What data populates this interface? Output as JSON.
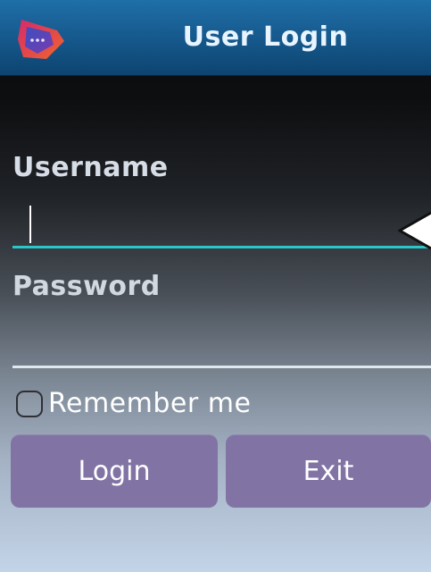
{
  "header": {
    "title": "User Login",
    "logo_icon": "app-logo-icon"
  },
  "form": {
    "username": {
      "label": "Username",
      "value": "",
      "focused": true
    },
    "password": {
      "label": "Password",
      "value": ""
    },
    "remember": {
      "label": "Remember me",
      "checked": false
    }
  },
  "buttons": {
    "login_label": "Login",
    "exit_label": "Exit"
  },
  "colors": {
    "titlebar": "#15578a",
    "focus_underline": "#2bc6c9",
    "button": "#8174a4"
  }
}
